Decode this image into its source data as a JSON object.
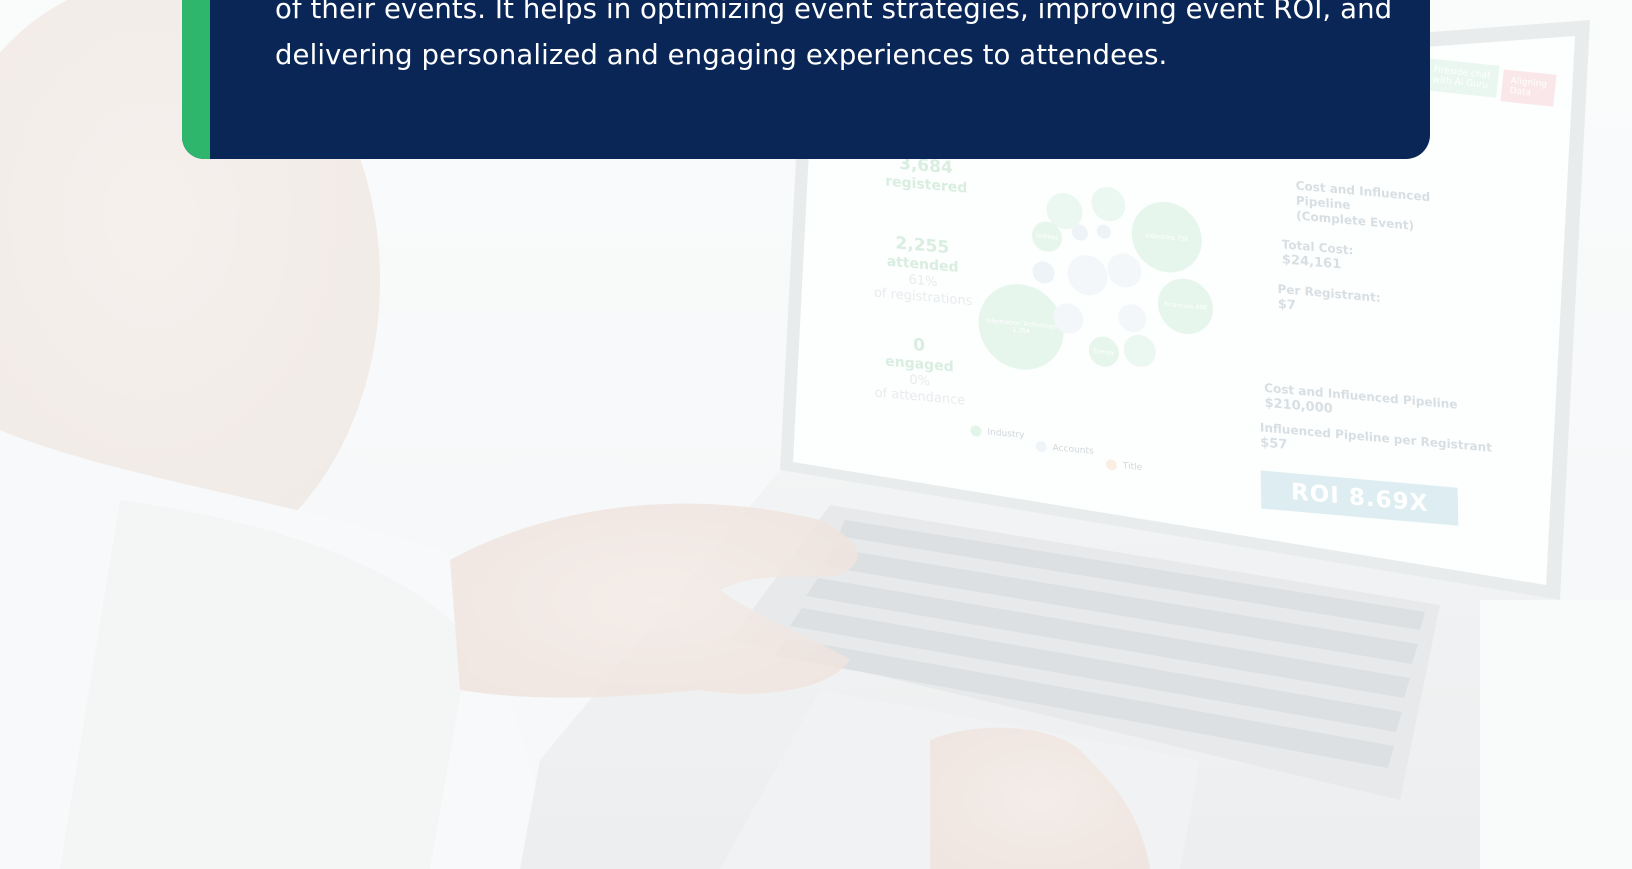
{
  "callout": {
    "lines": [
      "of their events. It helps in optimizing event strategies, improving event ROI, and",
      "delivering personalized and engaging experiences to attendees."
    ],
    "bg_color": "#0a2657",
    "accent_color": "#2fb66d"
  },
  "screen": {
    "metrics": [
      {
        "num": "3,684",
        "label": "registered",
        "sub": ""
      },
      {
        "num": "2,255",
        "label": "attended",
        "pct": "61%",
        "sub": "of registrations"
      },
      {
        "num": "0",
        "label": "engaged",
        "pct": "0%",
        "sub": "of attendance"
      }
    ],
    "bubbles": [
      {
        "label": "Industries\n756"
      },
      {
        "label": "Financials\n468"
      },
      {
        "label": "Information\nTechnology\n1,354"
      },
      {
        "label": "Energy"
      },
      {
        "label": "Utilities"
      }
    ],
    "legend": [
      "Industry",
      "Accounts",
      "Title"
    ],
    "tags": {
      "green": "Fireside chat\nwith AI Guru",
      "red": "Aligning\nData"
    },
    "pipeline_title": "Cost and Influenced Pipeline\n(Complete Event)",
    "total_cost_label": "Total Cost:",
    "total_cost_value": "$24,161",
    "per_registrant_label": "Per Registrant:",
    "per_registrant_value": "$7",
    "influenced_label": "Cost and Influenced Pipeline",
    "influenced_value": "$210,000",
    "influenced_per_label": "Influenced Pipeline per Registrant",
    "influenced_per_value": "$57",
    "roi": "ROI 8.69X"
  }
}
